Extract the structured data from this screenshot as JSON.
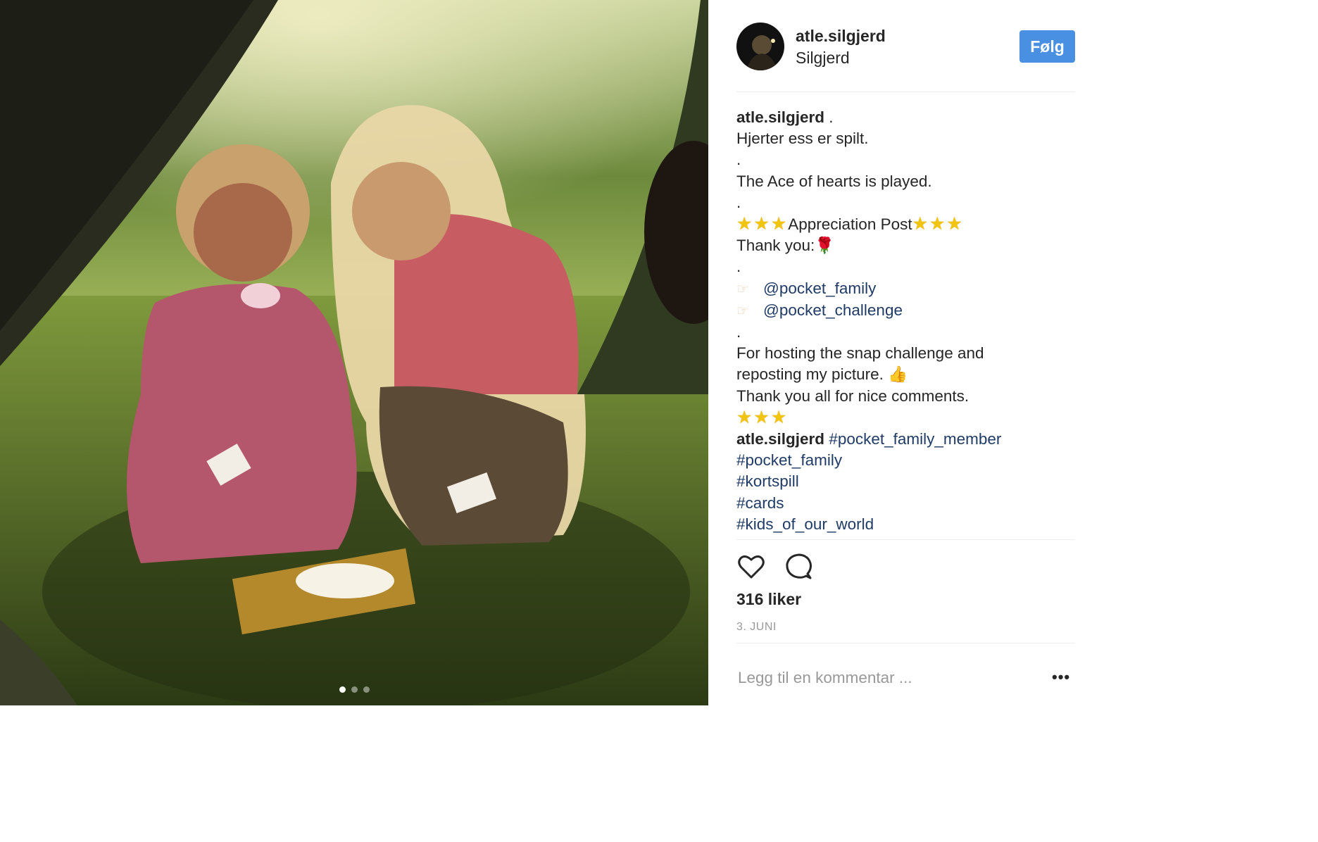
{
  "post": {
    "username": "atle.silgjerd",
    "location": "Silgjerd",
    "follow_label": "Følg",
    "photo_alt": "Two children playing cards in front of a tent",
    "carousel": {
      "count": 3,
      "active": 0
    }
  },
  "caption": {
    "author": "atle.silgjerd",
    "author_suffix": " .",
    "line_1": "Hjerter ess er spilt.",
    "dot_1": ".",
    "line_2": "The Ace of hearts is played.",
    "dot_2": ".",
    "appreciation_text": "Appreciation Post",
    "thank_you": "Thank you:",
    "dot_3": ".",
    "mention_1": "@pocket_family",
    "mention_2": "@pocket_challenge",
    "dot_4": ".",
    "line_3": "For hosting the snap challenge and",
    "line_4": "reposting my picture.",
    "line_5": "Thank you all for nice comments."
  },
  "comment": {
    "author": "atle.silgjerd",
    "hashtags": [
      "#pocket_family_member",
      "#pocket_family",
      "#kortspill",
      "#cards",
      "#kids_of_our_world"
    ]
  },
  "stats": {
    "likes": "316 liker",
    "date": "3. JUNI"
  },
  "comment_box": {
    "placeholder": "Legg til en kommentar ..."
  },
  "icons": {
    "like": "heart-icon",
    "comment": "comment-icon",
    "more": "more-options-icon",
    "pointer": "pointing-finger-icon",
    "star": "star-icon",
    "rose": "rose-icon",
    "thumbs_up": "thumbs-up-icon"
  },
  "colors": {
    "follow_button": "#4a90e2",
    "link": "#1f3b66",
    "text": "#262626",
    "muted": "#999999"
  }
}
